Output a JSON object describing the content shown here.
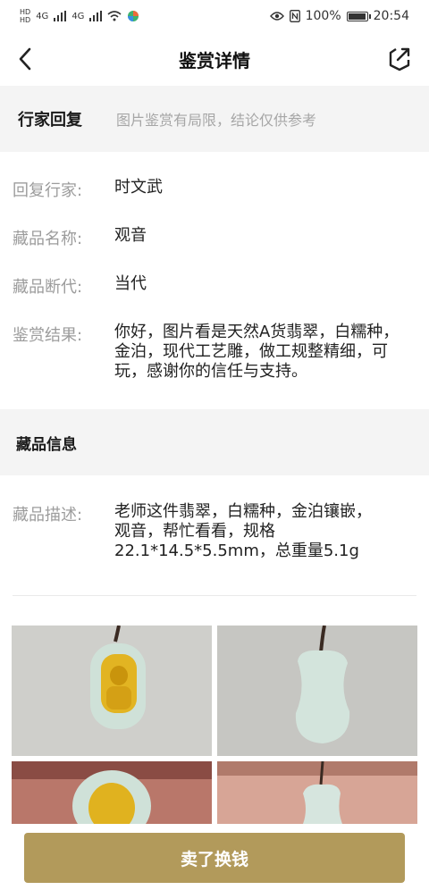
{
  "status_bar": {
    "hd_top": "HD",
    "hd_bottom": "HD",
    "net1": "4G",
    "net2": "4G",
    "battery": "100%",
    "battery_level": 1.0,
    "time": "20:54"
  },
  "header": {
    "title": "鉴赏详情",
    "back_icon": "chevron-left-icon",
    "share_icon": "share-icon"
  },
  "reply_section": {
    "title": "行家回复",
    "note": "图片鉴赏有局限，结论仅供参考",
    "fields": [
      {
        "label": "回复行家:",
        "value": "时文武"
      },
      {
        "label": "藏品名称:",
        "value": "观音"
      },
      {
        "label": "藏品断代:",
        "value": "当代"
      },
      {
        "label": "鉴赏结果:",
        "value": "你好，图片看是天然A货翡翠，白糯种，金泊，现代工艺雕，做工规整精细，可玩，感谢你的信任与支持。"
      }
    ]
  },
  "info_section": {
    "title": "藏品信息",
    "desc_label": "藏品描述:",
    "desc_value": "老师这件翡翠，白糯种，金泊镶嵌，观音，帮忙看看，规格22.1*14.5*5.5mm，总重量5.1g"
  },
  "bottom_button": {
    "label": "卖了换钱",
    "color": "#b29a5b"
  }
}
